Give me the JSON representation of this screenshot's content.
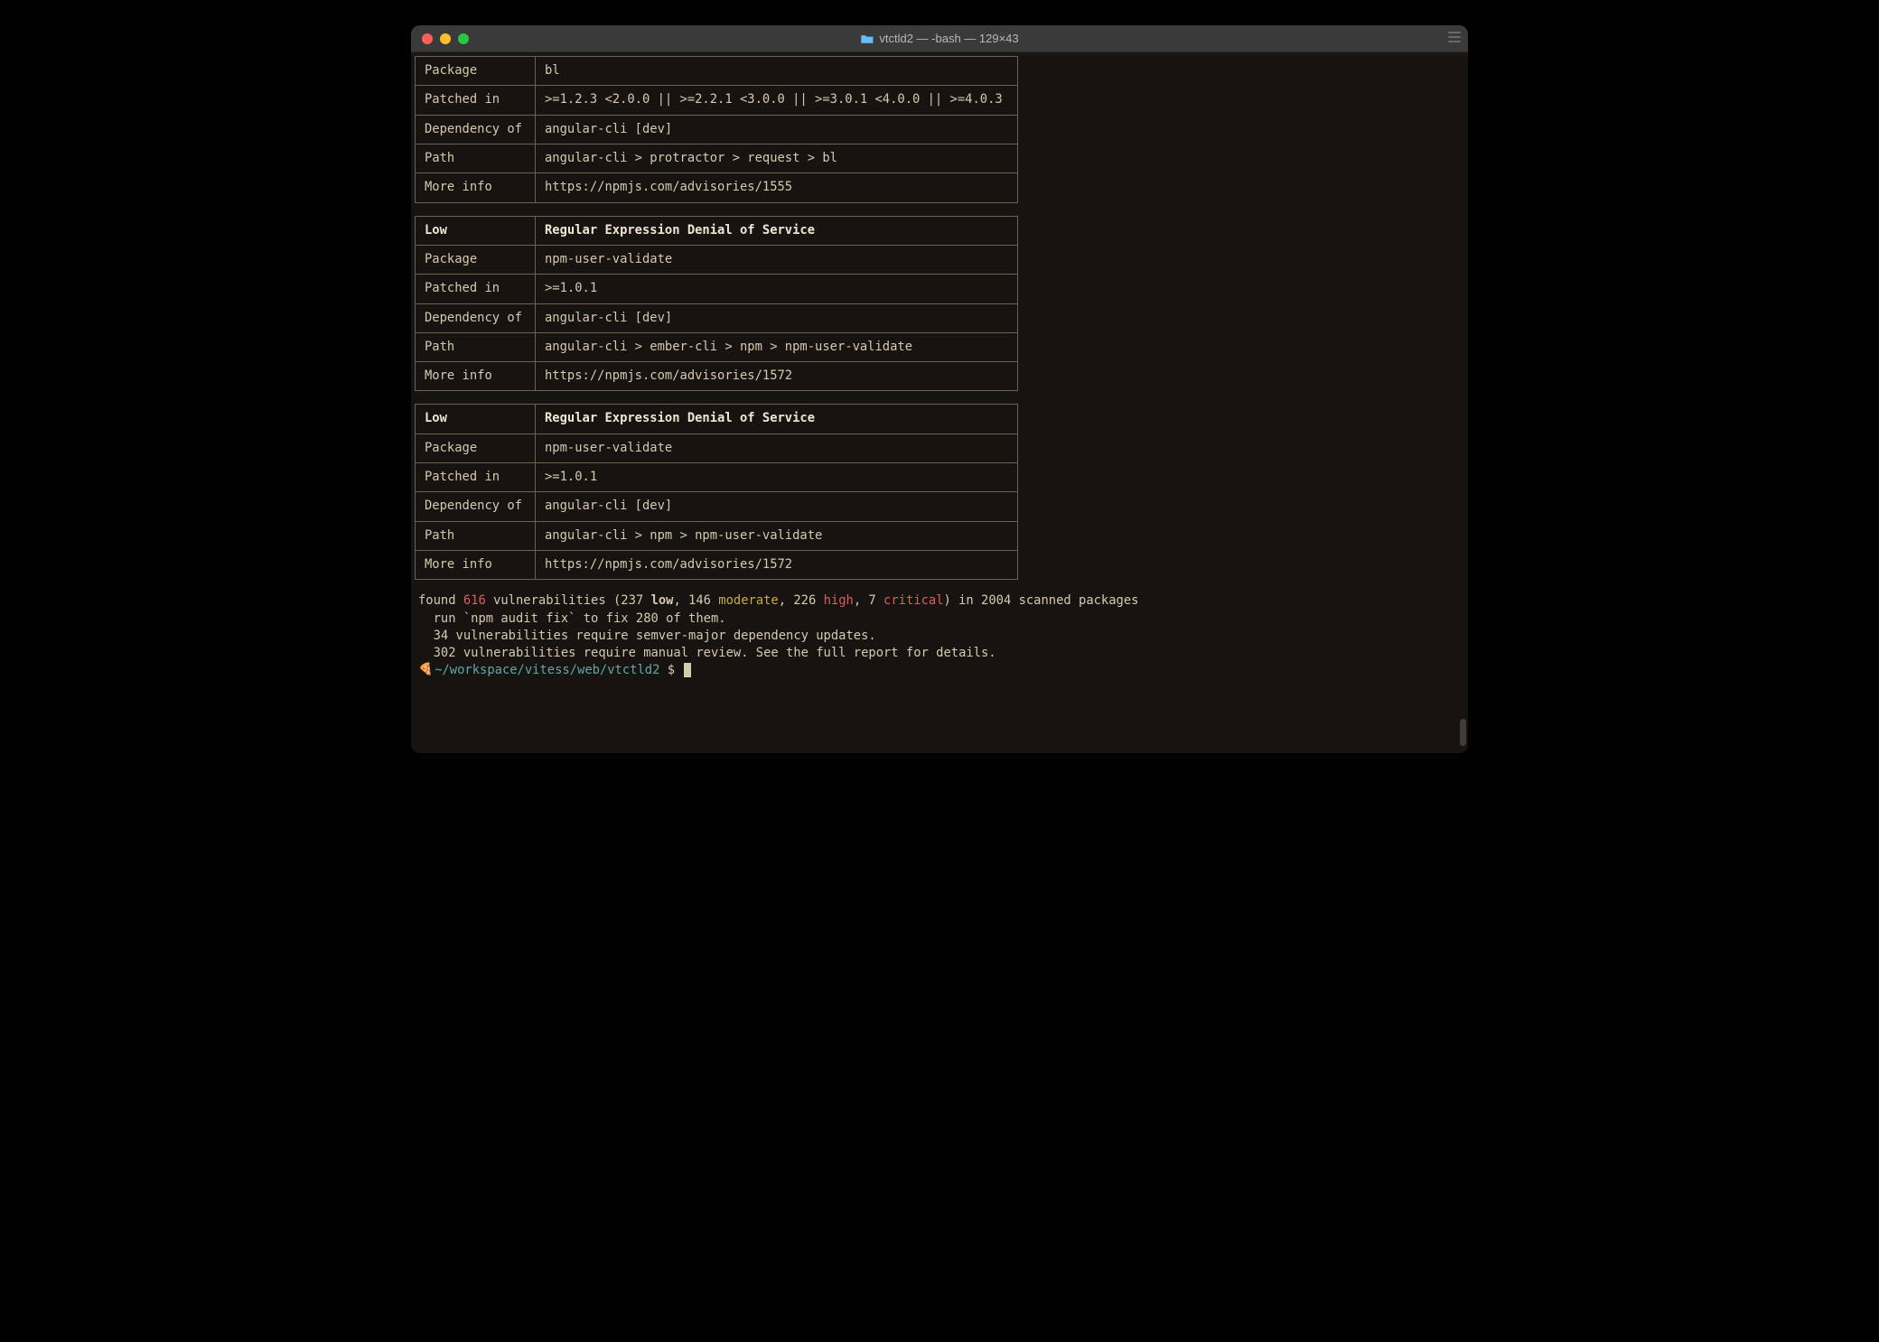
{
  "window": {
    "title": "vtctld2 — -bash — 129×43"
  },
  "tables": [
    {
      "rows": [
        {
          "label": "Package",
          "value": "bl"
        },
        {
          "label": "Patched in",
          "value": ">=1.2.3 <2.0.0 || >=2.2.1 <3.0.0 || >=3.0.1 <4.0.0 || >=4.0.3"
        },
        {
          "label": "Dependency of",
          "value": "angular-cli [dev]"
        },
        {
          "label": "Path",
          "value": "angular-cli > protractor > request > bl"
        },
        {
          "label": "More info",
          "value": "https://npmjs.com/advisories/1555"
        }
      ]
    },
    {
      "severity": "Low",
      "title": "Regular Expression Denial of Service",
      "rows": [
        {
          "label": "Package",
          "value": "npm-user-validate"
        },
        {
          "label": "Patched in",
          "value": ">=1.0.1"
        },
        {
          "label": "Dependency of",
          "value": "angular-cli [dev]"
        },
        {
          "label": "Path",
          "value": "angular-cli > ember-cli > npm > npm-user-validate"
        },
        {
          "label": "More info",
          "value": "https://npmjs.com/advisories/1572"
        }
      ]
    },
    {
      "severity": "Low",
      "title": "Regular Expression Denial of Service",
      "rows": [
        {
          "label": "Package",
          "value": "npm-user-validate"
        },
        {
          "label": "Patched in",
          "value": ">=1.0.1"
        },
        {
          "label": "Dependency of",
          "value": "angular-cli [dev]"
        },
        {
          "label": "Path",
          "value": "angular-cli > npm > npm-user-validate"
        },
        {
          "label": "More info",
          "value": "https://npmjs.com/advisories/1572"
        }
      ]
    }
  ],
  "summary": {
    "found_prefix": "found ",
    "total": "616",
    "vuln_word": " vulnerabilities (237 ",
    "low_label": "low",
    "moderate_prefix": ", 146 ",
    "moderate_label": "moderate",
    "high_prefix": ", 226 ",
    "high_label": "high",
    "critical_prefix": ", 7 ",
    "critical_label": "critical",
    "scanned_suffix": ") in 2004 scanned packages",
    "line2": "  run `npm audit fix` to fix 280 of them.",
    "line3": "  34 vulnerabilities require semver-major dependency updates.",
    "line4": "  302 vulnerabilities require manual review. See the full report for details."
  },
  "prompt": {
    "emoji": "🍕",
    "path": "~/workspace/vitess/web/vtctld2",
    "symbol": " $ "
  }
}
